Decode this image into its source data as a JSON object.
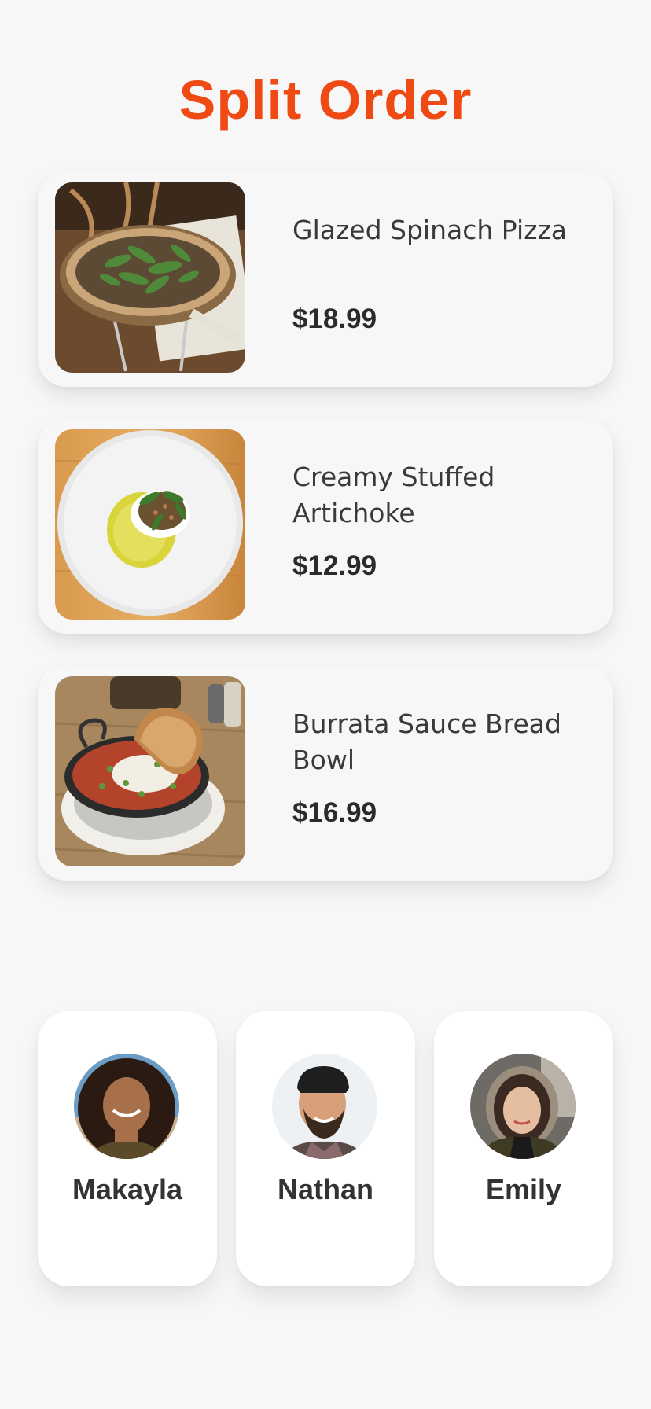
{
  "header": {
    "title": "Split Order"
  },
  "menu_items": [
    {
      "name": "Glazed Spinach Pizza",
      "price": "$18.99",
      "photo": "pizza-photo"
    },
    {
      "name": "Creamy Stuffed Artichoke",
      "price": "$12.99",
      "photo": "artichoke-photo"
    },
    {
      "name": "Burrata Sauce Bread Bowl",
      "price": "$16.99",
      "photo": "bread-bowl-photo"
    }
  ],
  "people": [
    {
      "name": "Makayla",
      "avatar": "makayla-avatar"
    },
    {
      "name": "Nathan",
      "avatar": "nathan-avatar"
    },
    {
      "name": "Emily",
      "avatar": "emily-avatar"
    }
  ],
  "colors": {
    "accent": "#f04a14",
    "background": "#f7f7f7",
    "card": "#ffffff"
  }
}
